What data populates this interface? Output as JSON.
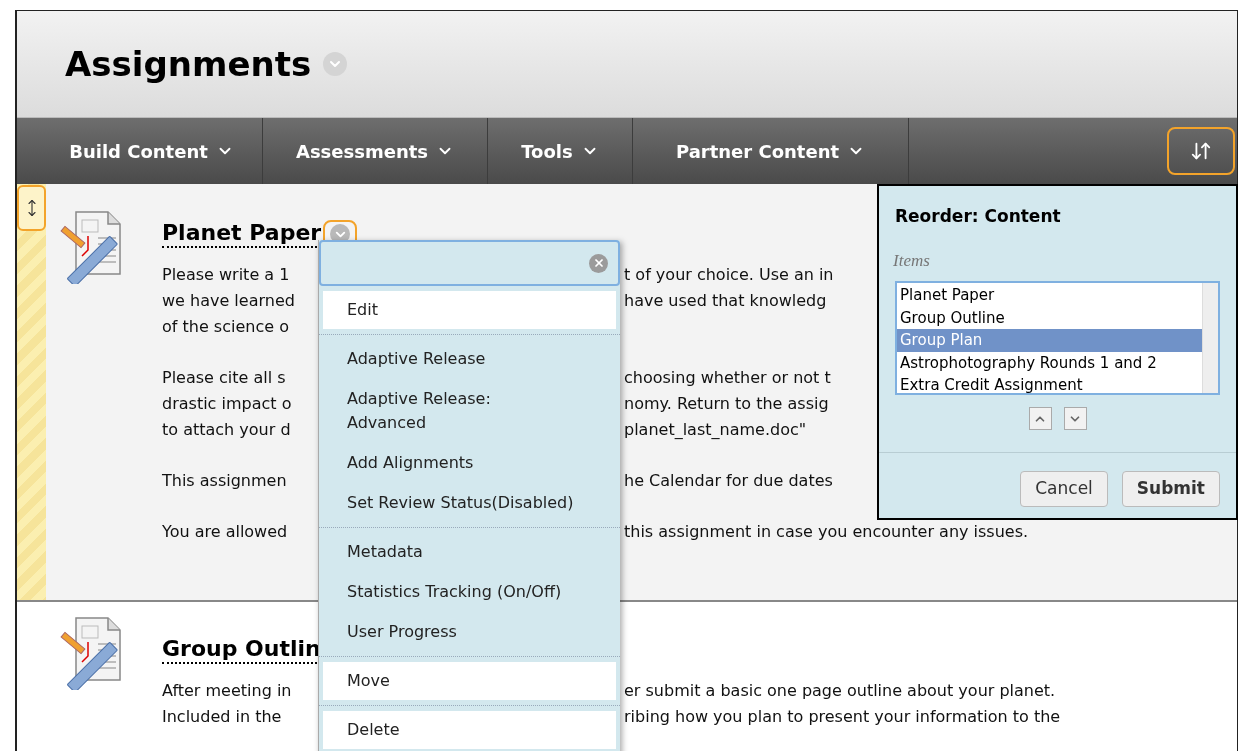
{
  "page_title": "Assignments",
  "toolbar": {
    "items": [
      {
        "label": "Build Content"
      },
      {
        "label": "Assessments"
      },
      {
        "label": "Tools"
      },
      {
        "label": "Partner Content"
      }
    ]
  },
  "content_items": [
    {
      "title": "Planet Paper",
      "selected": true,
      "paragraphs": [
        [
          {
            "left": "Please write a 1",
            "right": "t of your choice. Use an in"
          },
          {
            "left": "we have learned",
            "right": "have used that knowledg"
          },
          {
            "left": "of the science o"
          }
        ],
        [
          {
            "left": "Please cite all s",
            "right": "choosing whether or not t"
          },
          {
            "left": "drastic impact o",
            "right": "nomy. Return to the assig"
          },
          {
            "left": "to attach your d",
            "right": "planet_last_name.doc\""
          }
        ],
        [
          {
            "left": "This assignmen",
            "right": "he Calendar for due dates"
          }
        ],
        [
          {
            "left": "You are allowed",
            "right": "this assignment in case you encounter any issues."
          }
        ]
      ]
    },
    {
      "title": "Group Outlin",
      "selected": false,
      "paragraphs": [
        [
          {
            "left": "After meeting in",
            "right": "er submit a basic one page outline about your planet."
          },
          {
            "left": "Included in the",
            "right": "ribing how you plan to present your information to the"
          }
        ]
      ]
    }
  ],
  "context_menu": {
    "groups": [
      {
        "items": [
          {
            "label": "Edit",
            "highlighted": true
          }
        ]
      },
      {
        "items": [
          {
            "label": "Adaptive Release",
            "highlighted": false
          },
          {
            "label": "Adaptive Release: Advanced",
            "highlighted": false
          },
          {
            "label": "Add Alignments",
            "highlighted": false
          },
          {
            "label": "Set Review Status(Disabled)",
            "highlighted": false
          }
        ]
      },
      {
        "items": [
          {
            "label": "Metadata",
            "highlighted": false
          },
          {
            "label": "Statistics Tracking (On/Off)",
            "highlighted": false
          },
          {
            "label": "User Progress",
            "highlighted": false
          }
        ]
      },
      {
        "items": [
          {
            "label": "Move",
            "highlighted": true
          }
        ]
      },
      {
        "items": [
          {
            "label": "Delete",
            "highlighted": true
          }
        ]
      }
    ]
  },
  "reorder_panel": {
    "title": "Reorder: Content",
    "list_label": "Items",
    "items": [
      {
        "label": "Planet Paper",
        "selected": false
      },
      {
        "label": "Group Outline",
        "selected": false
      },
      {
        "label": "Group Plan",
        "selected": true
      },
      {
        "label": "Astrophotography Rounds 1 and 2",
        "selected": false
      },
      {
        "label": "Extra Credit Assignment",
        "selected": false
      }
    ],
    "buttons": [
      {
        "label": "Cancel",
        "kind": "secondary"
      },
      {
        "label": "Submit",
        "kind": "primary"
      }
    ]
  }
}
